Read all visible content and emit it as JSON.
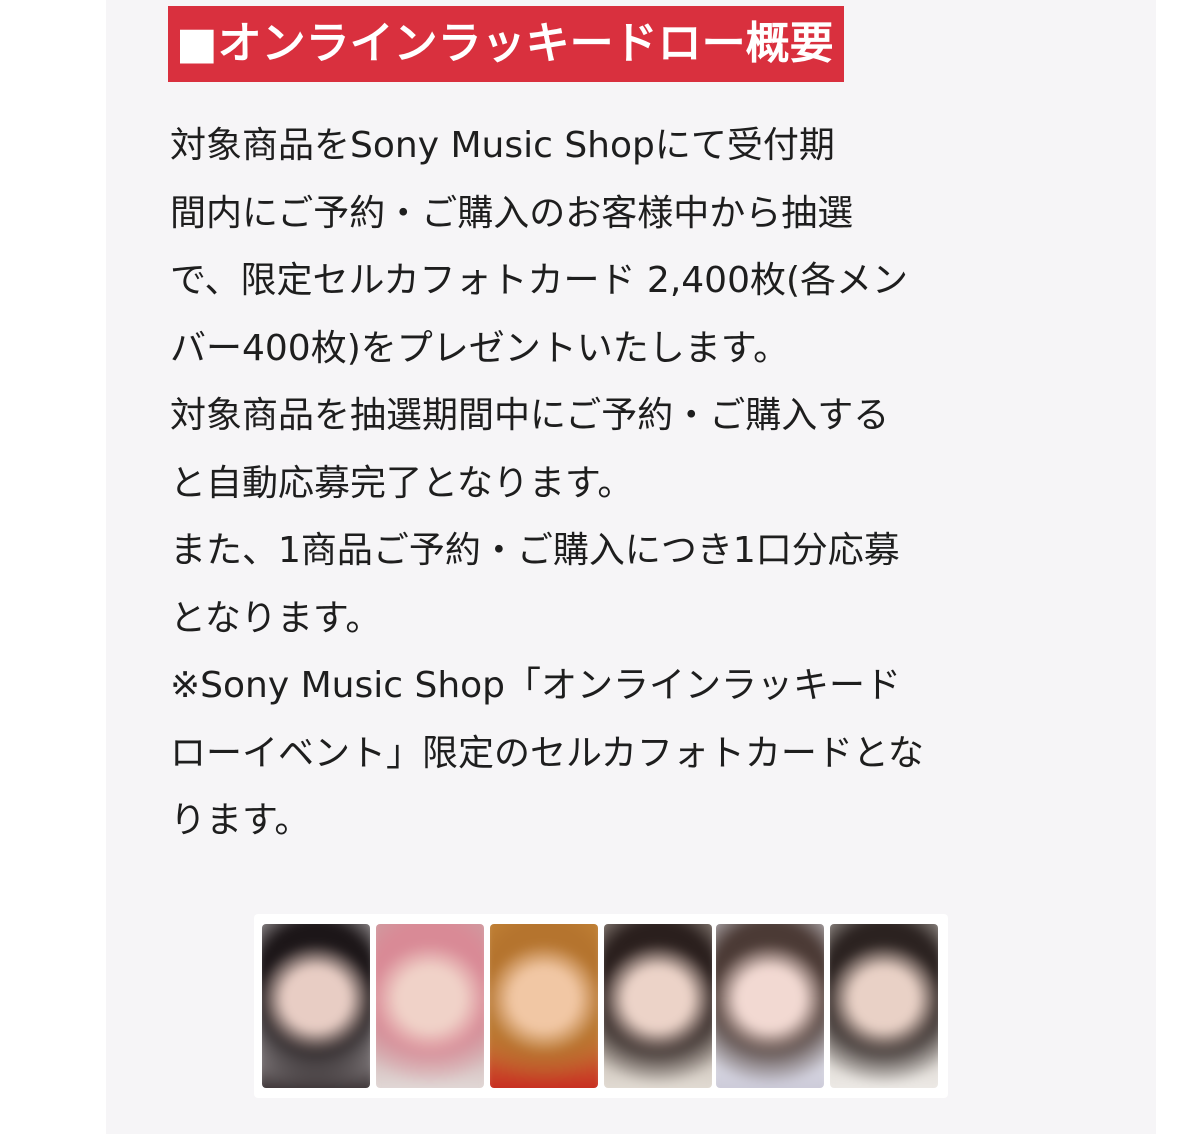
{
  "section": {
    "title": "■オンラインラッキードロー概要"
  },
  "body": {
    "lines": [
      "対象商品をSony Music Shopにて受付期",
      "間内にご予約・ご購入のお客様中から抽選",
      "で、限定セルカフォトカード 2,400枚(各メン",
      "バー400枚)をプレゼントいたします。",
      "対象商品を抽選期間中にご予約・ご購入する",
      "と自動応募完了となります。",
      "また、1商品ご予約・ご購入につき1口分応募",
      "となります。",
      "※Sony Music Shop「オンラインラッキード",
      "ローイベント」限定のセルカフォトカードとな",
      "ります。"
    ]
  },
  "photo_cards": [
    {
      "icon": "photo-card-image",
      "bg": "#d9d4d6",
      "hair": "#1c1618",
      "face": "#e8cdc4",
      "accent": "#2a2224"
    },
    {
      "icon": "photo-card-image",
      "bg": "#c9a6a6",
      "hair": "#d98a96",
      "face": "#f0d2c8",
      "accent": "#e4dedc"
    },
    {
      "icon": "photo-card-image",
      "bg": "#c98a3a",
      "hair": "#b5742e",
      "face": "#f1c7a4",
      "accent": "#c8221e"
    },
    {
      "icon": "photo-card-image",
      "bg": "#bdb2a8",
      "hair": "#2a1f1d",
      "face": "#ecd3c8",
      "accent": "#e6e0d8"
    },
    {
      "icon": "photo-card-image",
      "bg": "#e7e8ef",
      "hair": "#4b3a35",
      "face": "#f2d9d2",
      "accent": "#c9c7d6"
    },
    {
      "icon": "photo-card-image",
      "bg": "#cfc9c3",
      "hair": "#2b2220",
      "face": "#e9d1c6",
      "accent": "#f1eeea"
    }
  ]
}
